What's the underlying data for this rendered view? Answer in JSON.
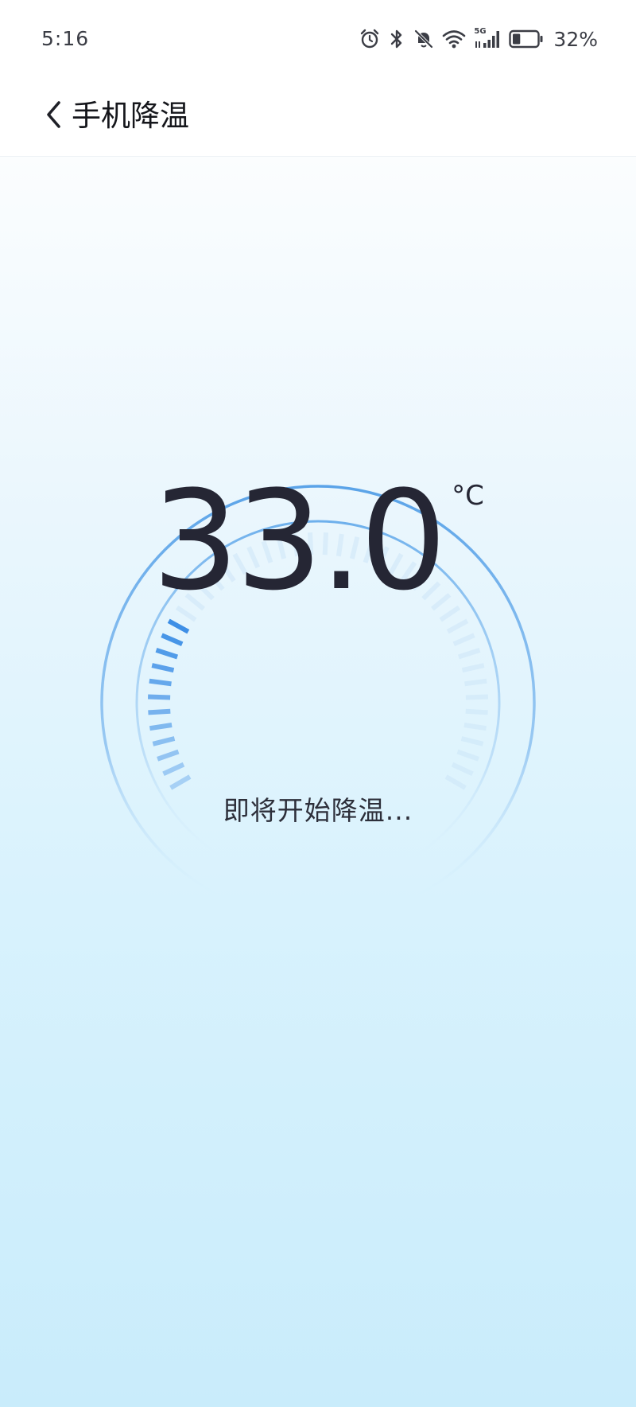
{
  "status_bar": {
    "time": "5:16",
    "network": "5G",
    "battery_percent": "32%",
    "battery_level": 0.32,
    "icons": [
      "alarm-icon",
      "bluetooth-icon",
      "mute-bell-icon",
      "wifi-icon",
      "signal-icon",
      "battery-icon"
    ]
  },
  "header": {
    "title": "手机降温",
    "back_icon": "chevron-left-icon"
  },
  "gauge": {
    "temperature": "33.0",
    "unit": "°C",
    "message": "即将开始降温...",
    "accent_color": "#5aa3e8",
    "active_color": "#3e8fe6"
  }
}
